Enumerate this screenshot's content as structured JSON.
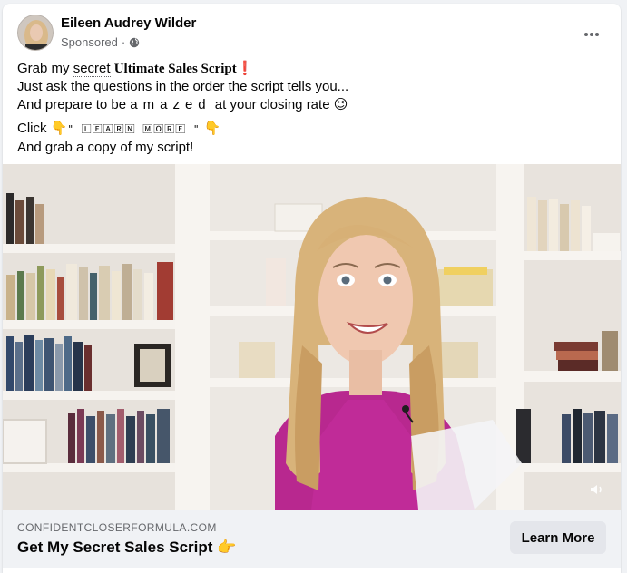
{
  "post": {
    "author": "Eileen Audrey Wilder",
    "sponsored": "Sponsored",
    "separator": "·",
    "privacy_icon": "globe-icon",
    "more_icon": "more-options-icon"
  },
  "body": {
    "line1_pre": "Grab my ",
    "line1_secret": "secret",
    "line1_bold": "Ultimate Sales Script",
    "line1_emoji": "❗",
    "line2": "Just ask the questions in the order the script tells you...",
    "line3_pre": "And prepare to be ",
    "line3_spaced": "amazed",
    "line3_post": " at your closing rate ",
    "line3_emoji": "😉",
    "line4_pre": "Click ",
    "line4_emoji": "👇",
    "line4_button": "\" 🄻🄴🄰🅁🄽 🄼🄾🅁🄴 \"",
    "line4_emoji2": "👇",
    "line5": "And grab a copy of my script!"
  },
  "media": {
    "volume_icon": "volume-icon"
  },
  "cta": {
    "domain": "CONFIDENTCLOSERFORMULA.COM",
    "headline": "Get My Secret Sales Script",
    "headline_emoji": "👉",
    "button": "Learn More"
  }
}
